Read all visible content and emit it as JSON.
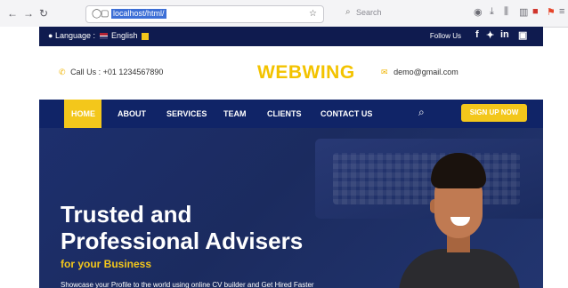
{
  "browser": {
    "url_text": "localhost/html/",
    "search_placeholder": "Search"
  },
  "topbar": {
    "language_label": "Language :",
    "language_value": "English",
    "follow_label": "Follow Us",
    "socials": [
      "f",
      "t",
      "in",
      "ig"
    ]
  },
  "header": {
    "call_label": "Call Us : +01 1234567890",
    "brand": "WEBWING",
    "email": "demo@gmail.com"
  },
  "nav": {
    "items": [
      "HOME",
      "ABOUT",
      "SERVICES",
      "TEAM",
      "CLIENTS",
      "CONTACT US"
    ],
    "signup": "SIGN UP NOW"
  },
  "hero": {
    "line1": "Trusted and",
    "line2": "Professional Advisers",
    "subtitle": "for your Business",
    "description": "Showcase your Profile to the world using online CV builder and Get Hired Faster"
  },
  "colors": {
    "navy": "#0f1b4f",
    "nav": "#102467",
    "accent": "#f3c71b"
  }
}
